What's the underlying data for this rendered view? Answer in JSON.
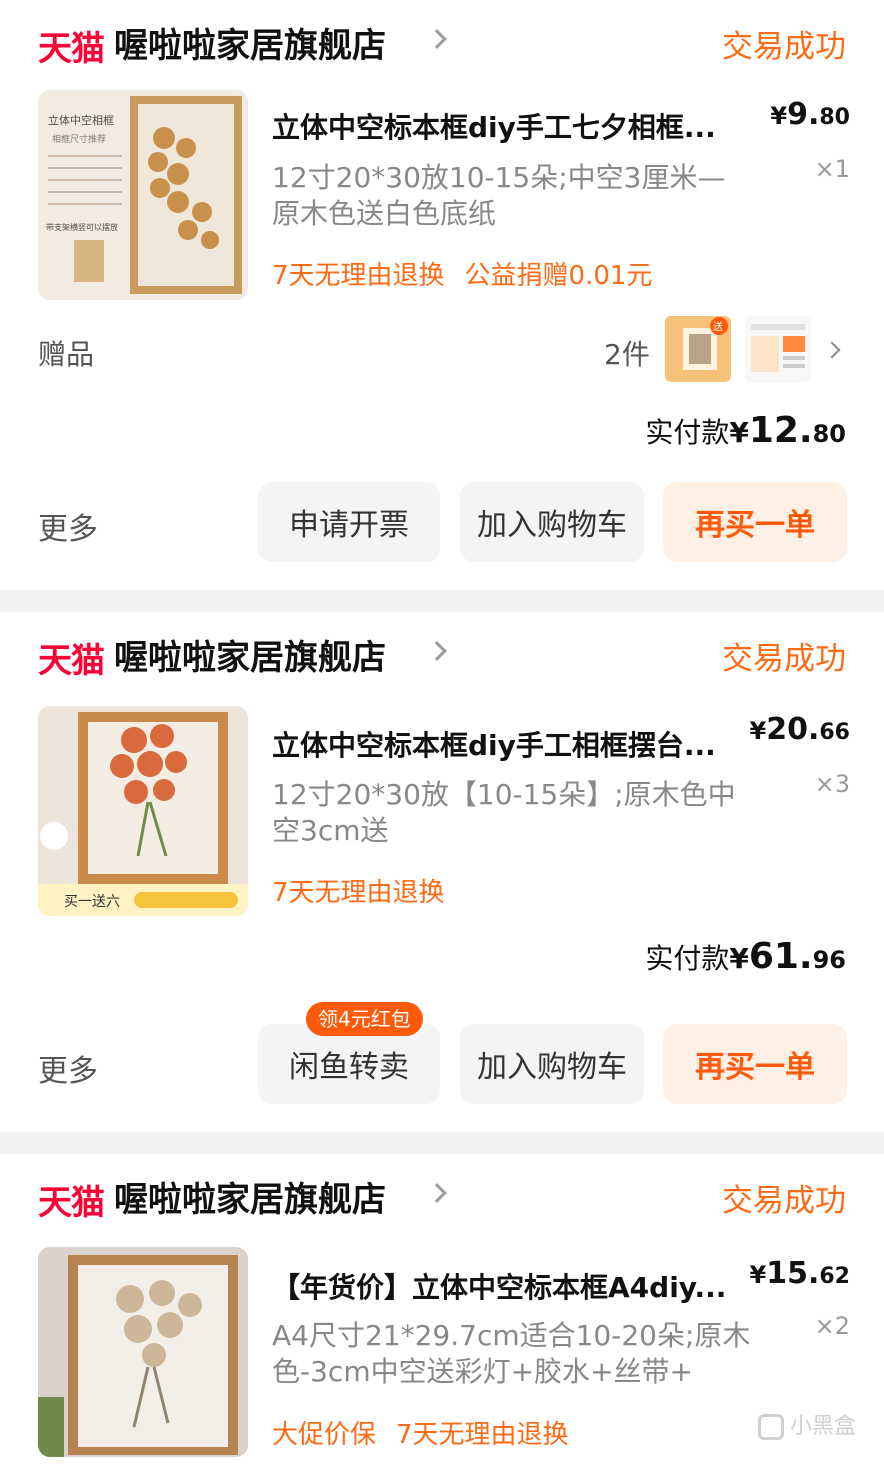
{
  "orders": [
    {
      "shop": {
        "platform": "天猫",
        "name": "喔啦啦家居旗舰店",
        "status": "交易成功"
      },
      "item": {
        "title": "立体中空标本框diy手工七夕相框...",
        "price": {
          "symbol": "¥",
          "int": "9.",
          "dec": "80"
        },
        "qty": "×1",
        "sku": "12寸20*30放10-15朵;中空3厘米—原木色送白色底纸",
        "tags": [
          "7天无理由退换",
          "公益捐赠0.01元"
        ]
      },
      "gift": {
        "label": "赠品",
        "count": "2件"
      },
      "paid": {
        "label": "实付款",
        "symbol": "¥",
        "int": "12.",
        "dec": "80"
      },
      "actions": {
        "more": "更多",
        "b1": "申请开票",
        "b2": "加入购物车",
        "b3": "再买一单"
      }
    },
    {
      "shop": {
        "platform": "天猫",
        "name": "喔啦啦家居旗舰店",
        "status": "交易成功"
      },
      "item": {
        "title": "立体中空标本框diy手工相框摆台...",
        "price": {
          "symbol": "¥",
          "int": "20.",
          "dec": "66"
        },
        "qty": "×3",
        "sku": "12寸20*30放【10-15朵】;原木色中空3cm送",
        "tags": [
          "7天无理由退换"
        ]
      },
      "paid": {
        "label": "实付款",
        "symbol": "¥",
        "int": "61.",
        "dec": "96"
      },
      "actions": {
        "more": "更多",
        "badge": "领4元红包",
        "b1": "闲鱼转卖",
        "b2": "加入购物车",
        "b3": "再买一单"
      }
    },
    {
      "shop": {
        "platform": "天猫",
        "name": "喔啦啦家居旗舰店",
        "status": "交易成功"
      },
      "item": {
        "title": "【年货价】立体中空标本框A4diy...",
        "price": {
          "symbol": "¥",
          "int": "15.",
          "dec": "62"
        },
        "qty": "×2",
        "sku": "A4尺寸21*29.7cm适合10-20朵;原木色-3cm中空送彩灯+胶水+丝带+",
        "tags": [
          "大促价保",
          "7天无理由退换"
        ]
      }
    }
  ],
  "thumbnail_text": {
    "t1_heading": "立体中空相框",
    "t1_sub": "相框尺寸推荐",
    "t1_note": "带支架横竖可以摆放",
    "t2_banner": "买一送六",
    "gift1_badge": "送"
  },
  "watermark": "小黑盒",
  "colors": {
    "accent": "#ff6a14",
    "tmall": "#ff0036",
    "primary_btn_bg": "#fff0e6",
    "primary_btn_text": "#ff5a0a"
  }
}
